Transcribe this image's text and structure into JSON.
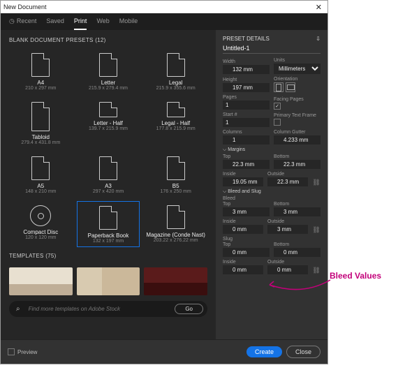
{
  "window_title": "New Document",
  "tabs": {
    "recent": "Recent",
    "saved": "Saved",
    "print": "Print",
    "web": "Web",
    "mobile": "Mobile"
  },
  "left": {
    "presets_heading": "BLANK DOCUMENT PRESETS (12)",
    "templates_heading": "TEMPLATES (75)",
    "search_placeholder": "Find more templates on Adobe Stock",
    "go": "Go"
  },
  "presets": [
    {
      "name": "A4",
      "sub": "210 x 297 mm"
    },
    {
      "name": "Letter",
      "sub": "215.9 x 279.4 mm"
    },
    {
      "name": "Legal",
      "sub": "215.9 x 355.6 mm"
    },
    {
      "name": "Tabloid",
      "sub": "279.4 x 431.8 mm"
    },
    {
      "name": "Letter - Half",
      "sub": "139.7 x 215.9 mm"
    },
    {
      "name": "Legal - Half",
      "sub": "177.8 x 215.9 mm"
    },
    {
      "name": "A5",
      "sub": "148 x 210 mm"
    },
    {
      "name": "A3",
      "sub": "297 x 420 mm"
    },
    {
      "name": "B5",
      "sub": "176 x 250 mm"
    },
    {
      "name": "Compact Disc",
      "sub": "120 x 120 mm"
    },
    {
      "name": "Paperback Book",
      "sub": "132 x 197 mm"
    },
    {
      "name": "Magazine (Conde Nast)",
      "sub": "203.22 x 276.22 mm"
    }
  ],
  "pd": {
    "heading": "PRESET DETAILS",
    "doc": "Untitled-1",
    "width_lbl": "Width",
    "width": "132 mm",
    "units_lbl": "Units",
    "units": "Millimeters",
    "height_lbl": "Height",
    "height": "197 mm",
    "orient_lbl": "Orientation",
    "pages_lbl": "Pages",
    "pages": "1",
    "facing_lbl": "Facing Pages",
    "facing_checked": "✓",
    "start_lbl": "Start #",
    "start": "1",
    "ptf_lbl": "Primary Text Frame",
    "cols_lbl": "Columns",
    "cols": "1",
    "gutter_lbl": "Column Gutter",
    "gutter": "4.233 mm",
    "margins_heading": "Margins",
    "top_lbl": "Top",
    "m_top": "22.3 mm",
    "bottom_lbl": "Bottom",
    "m_bottom": "22.3 mm",
    "inside_lbl": "Inside",
    "m_inside": "19.05 mm",
    "outside_lbl": "Outside",
    "m_outside": "22.3 mm",
    "bleed_heading": "Bleed and Slug",
    "bleed_lbl": "Bleed",
    "b_top": "3 mm",
    "b_bottom": "3 mm",
    "b_inside": "0 mm",
    "b_outside": "3 mm",
    "slug_lbl": "Slug",
    "s_top": "0 mm",
    "s_bottom": "0 mm",
    "s_inside": "0 mm",
    "s_outside": "0 mm"
  },
  "footer": {
    "preview": "Preview",
    "create": "Create",
    "close": "Close"
  },
  "annotation": "Bleed Values"
}
